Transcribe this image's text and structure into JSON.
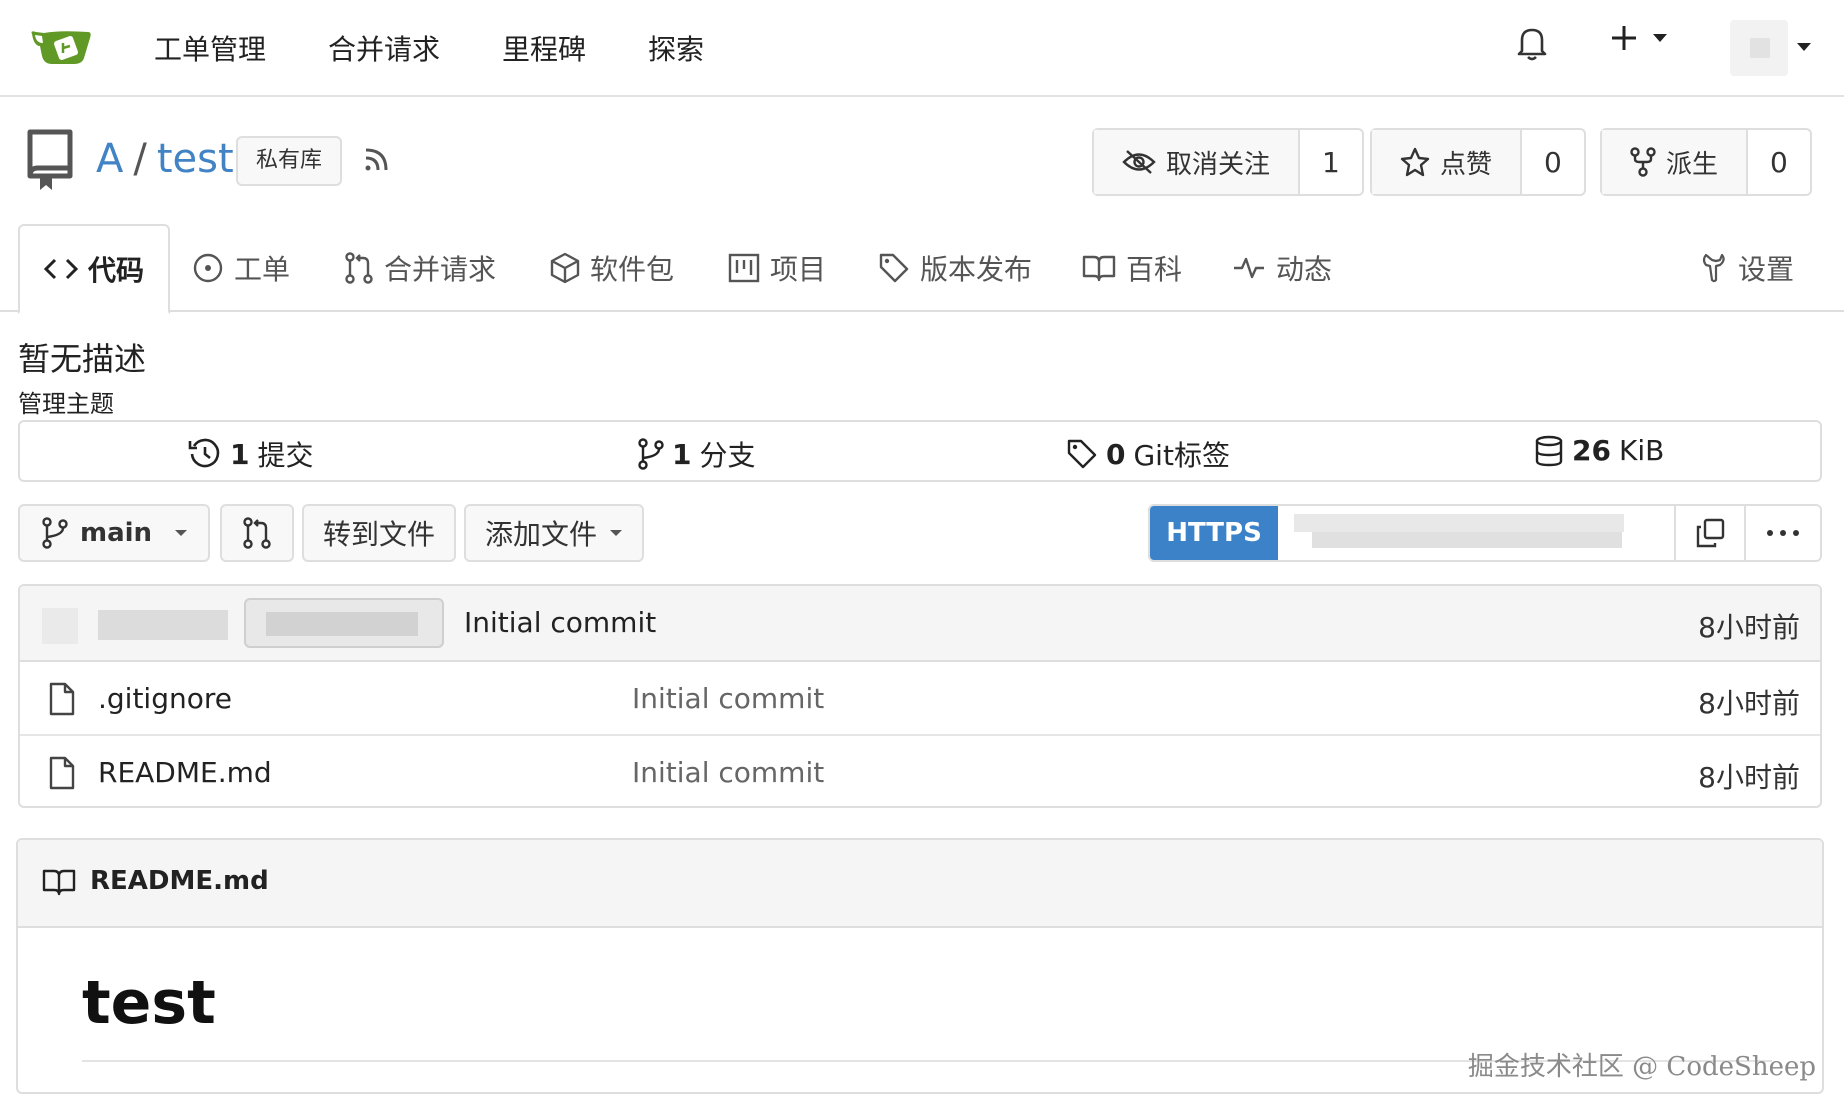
{
  "topnav": {
    "links": [
      "工单管理",
      "合并请求",
      "里程碑",
      "探索"
    ],
    "brand_color": "#609926"
  },
  "repo": {
    "owner": "A",
    "separator": "/",
    "name": "test",
    "visibility_badge": "私有库",
    "actions": {
      "unwatch_label": "取消关注",
      "watch_count": "1",
      "star_label": "点赞",
      "star_count": "0",
      "fork_label": "派生",
      "fork_count": "0"
    }
  },
  "tabs": [
    {
      "label": "代码",
      "icon": "code-icon",
      "active": true
    },
    {
      "label": "工单",
      "icon": "issue-icon"
    },
    {
      "label": "合并请求",
      "icon": "pull-request-icon"
    },
    {
      "label": "软件包",
      "icon": "package-icon"
    },
    {
      "label": "项目",
      "icon": "project-icon"
    },
    {
      "label": "版本发布",
      "icon": "tag-icon"
    },
    {
      "label": "百科",
      "icon": "book-icon"
    },
    {
      "label": "动态",
      "icon": "pulse-icon"
    },
    {
      "label": "设置",
      "icon": "tools-icon"
    }
  ],
  "description": "暂无描述",
  "topics_link": "管理主题",
  "stats": {
    "commits_count": "1",
    "commits_label": "提交",
    "branches_count": "1",
    "branches_label": "分支",
    "tags_count": "0",
    "tags_label": "Git标签",
    "size_value": "26",
    "size_unit": "KiB"
  },
  "toolbar": {
    "branch": "main",
    "goto_file": "转到文件",
    "add_file": "添加文件",
    "clone_protocol": "HTTPS",
    "accent": "#3c82c8"
  },
  "latest_commit": {
    "message": "Initial commit",
    "time": "8小时前"
  },
  "files": [
    {
      "name": ".gitignore",
      "commit": "Initial commit",
      "time": "8小时前"
    },
    {
      "name": "README.md",
      "commit": "Initial commit",
      "time": "8小时前"
    }
  ],
  "readme": {
    "file_name": "README.md",
    "heading": "test"
  },
  "watermark": "掘金技术社区 @ CodeSheep"
}
